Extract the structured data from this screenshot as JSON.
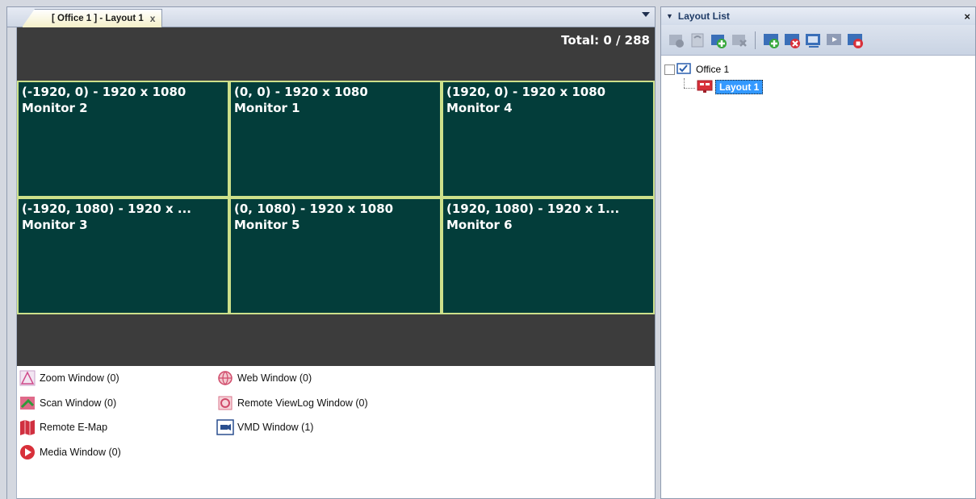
{
  "document_tab": {
    "title": "[ Office 1 ] - Layout 1",
    "close_glyph": "x"
  },
  "canvas": {
    "total_label": "Total: 0 / 288",
    "monitors": [
      {
        "resolution": "(-1920, 0) - 1920 x 1080",
        "name": "Monitor 2"
      },
      {
        "resolution": "(0, 0) - 1920 x 1080",
        "name": "Monitor 1"
      },
      {
        "resolution": "(1920, 0) - 1920 x 1080",
        "name": "Monitor 4"
      },
      {
        "resolution": "(-1920, 1080) - 1920 x ...",
        "name": "Monitor 3"
      },
      {
        "resolution": "(0, 1080) - 1920 x 1080",
        "name": "Monitor 5"
      },
      {
        "resolution": "(1920, 1080) - 1920 x 1...",
        "name": "Monitor 6"
      }
    ]
  },
  "window_list": {
    "zoom": "Zoom Window (0)",
    "scan": "Scan Window (0)",
    "emap": "Remote E-Map",
    "media": "Media Window (0)",
    "web": "Web Window (0)",
    "viewlog": "Remote ViewLog Window (0)",
    "vmd": "VMD Window (1)"
  },
  "layout_list": {
    "title": "Layout List",
    "close_glyph": "×",
    "tree": {
      "root": "Office 1",
      "child": "Layout 1"
    }
  },
  "colors": {
    "monitor_bg": "#033d3a",
    "monitor_border": "#cde08a",
    "selection": "#3399ff",
    "canvas_bg": "#3c3c3c"
  }
}
